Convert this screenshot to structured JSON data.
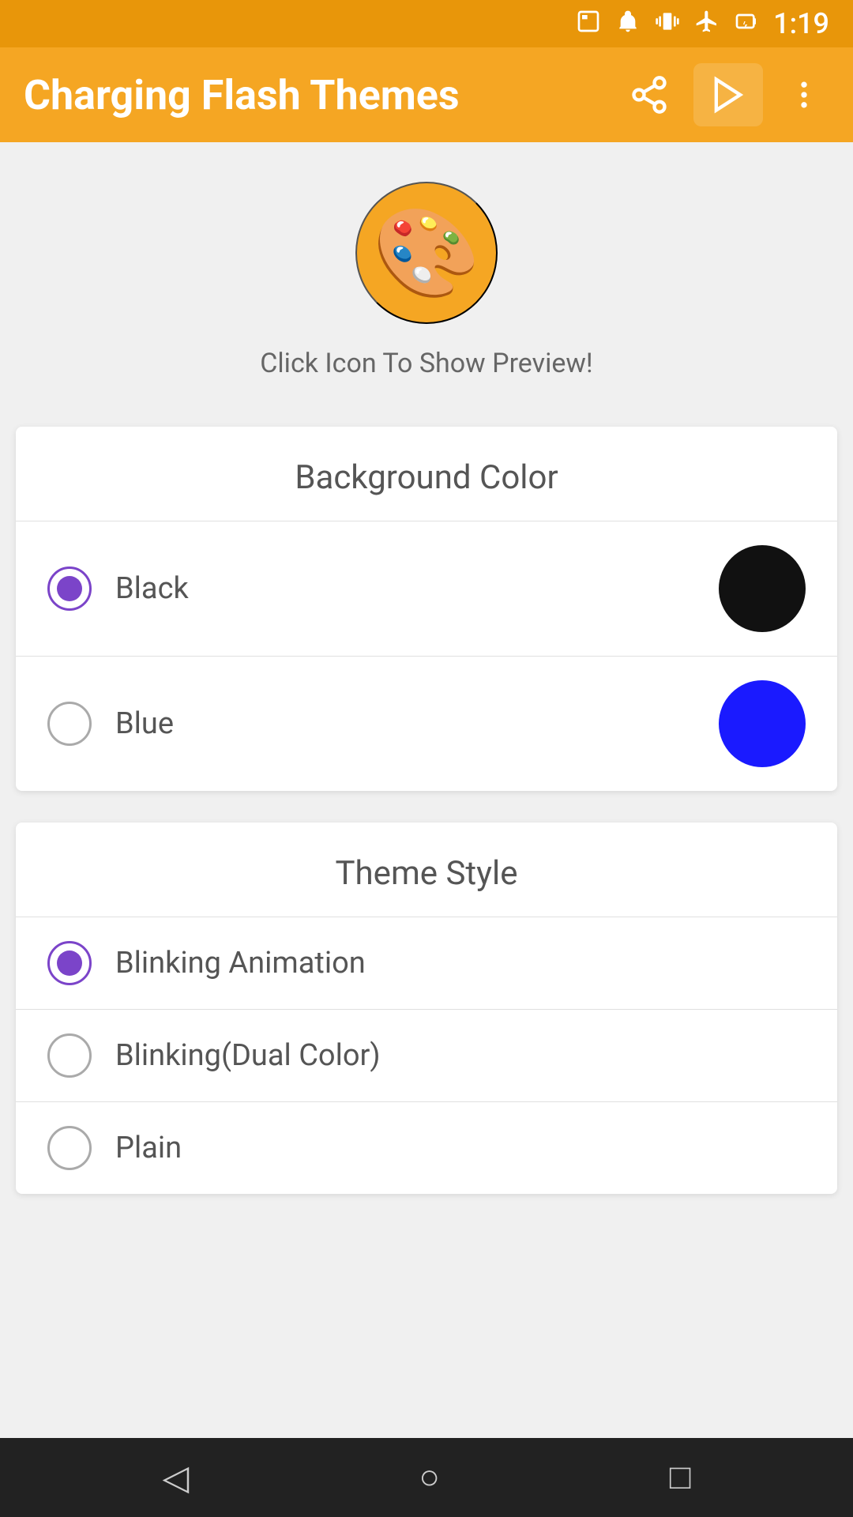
{
  "statusBar": {
    "time": "1:19",
    "icons": [
      "vibrate",
      "airplane",
      "battery-charging"
    ]
  },
  "appBar": {
    "title": "Charging Flash Themes",
    "actions": {
      "share": "share-icon",
      "playStore": "play-store-icon",
      "more": "more-icon"
    }
  },
  "hero": {
    "icon": "🎨",
    "instruction": "Click Icon To Show Preview!"
  },
  "backgroundColorCard": {
    "title": "Background Color",
    "options": [
      {
        "id": "black",
        "label": "Black",
        "color": "#111111",
        "selected": true
      },
      {
        "id": "blue",
        "label": "Blue",
        "color": "#1a1aff",
        "selected": false
      }
    ]
  },
  "themeStyleCard": {
    "title": "Theme Style",
    "options": [
      {
        "id": "blinking-animation",
        "label": "Blinking Animation",
        "selected": true
      },
      {
        "id": "blinking-dual-color",
        "label": "Blinking(Dual Color)",
        "selected": false
      },
      {
        "id": "plain",
        "label": "Plain",
        "selected": false
      }
    ]
  },
  "bottomNav": {
    "back": "◁",
    "home": "○",
    "recent": "□"
  },
  "colors": {
    "accent": "#f5a623",
    "radioSelected": "#7b44c9"
  }
}
